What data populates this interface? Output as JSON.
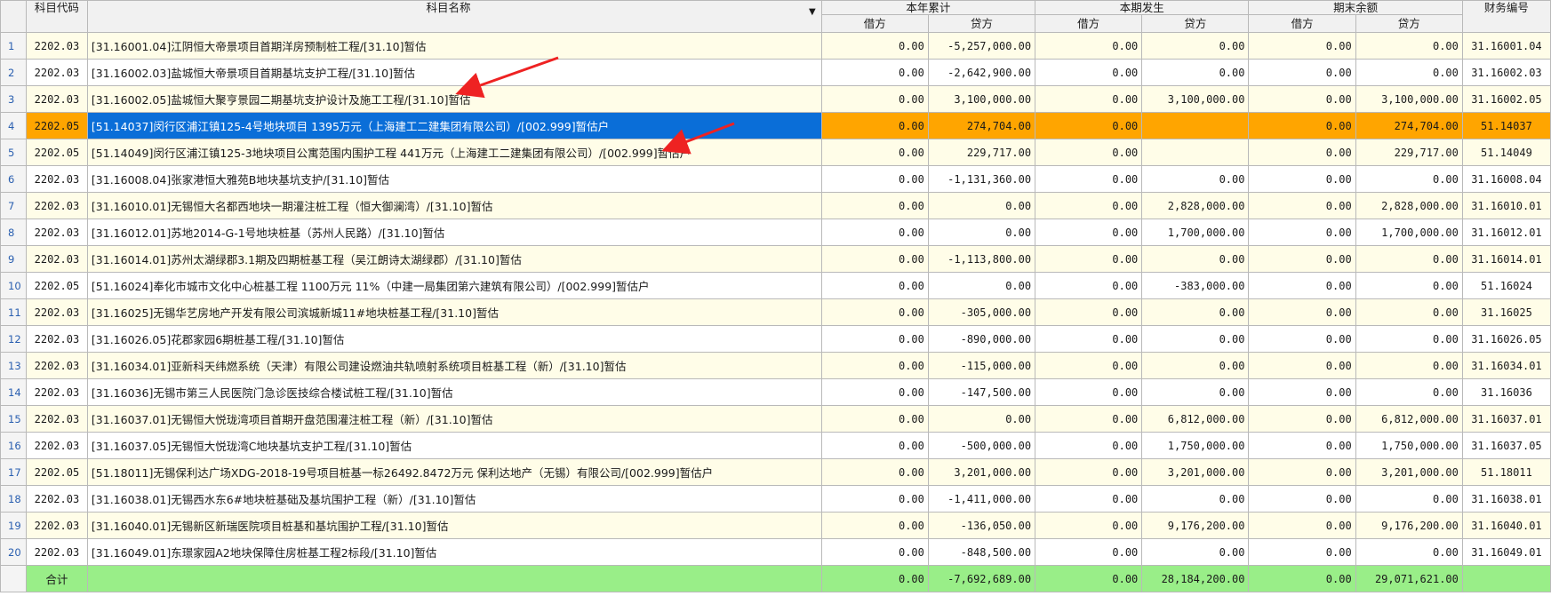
{
  "header": {
    "col_code": "科目代码",
    "col_name": "科目名称",
    "sort_icon": "sort-down-icon",
    "group_ytd": "本年累计",
    "group_period": "本期发生",
    "group_ending": "期末余额",
    "col_fin": "财务编号",
    "debit": "借方",
    "credit": "贷方"
  },
  "rows": [
    {
      "n": "1",
      "code": "2202.03",
      "name": "[31.16001.04]江阴恒大帝景项目首期洋房预制桩工程/[31.10]暂估",
      "ytd_d": "0.00",
      "ytd_c": "-5,257,000.00",
      "per_d": "0.00",
      "per_c": "0.00",
      "end_d": "0.00",
      "end_c": "0.00",
      "fin": "31.16001.04"
    },
    {
      "n": "2",
      "code": "2202.03",
      "name": "[31.16002.03]盐城恒大帝景项目首期基坑支护工程/[31.10]暂估",
      "ytd_d": "0.00",
      "ytd_c": "-2,642,900.00",
      "per_d": "0.00",
      "per_c": "0.00",
      "end_d": "0.00",
      "end_c": "0.00",
      "fin": "31.16002.03"
    },
    {
      "n": "3",
      "code": "2202.03",
      "name": "[31.16002.05]盐城恒大聚亨景园二期基坑支护设计及施工工程/[31.10]暂估",
      "ytd_d": "0.00",
      "ytd_c": "3,100,000.00",
      "per_d": "0.00",
      "per_c": "3,100,000.00",
      "end_d": "0.00",
      "end_c": "3,100,000.00",
      "fin": "31.16002.05"
    },
    {
      "n": "4",
      "code": "2202.05",
      "name": "[51.14037]闵行区浦江镇125-4号地块项目 1395万元（上海建工二建集团有限公司）/[002.999]暂估户",
      "ytd_d": "0.00",
      "ytd_c": "274,704.00",
      "per_d": "0.00",
      "per_c": "",
      "end_d": "0.00",
      "end_c": "274,704.00",
      "fin": "51.14037"
    },
    {
      "n": "5",
      "code": "2202.05",
      "name": "[51.14049]闵行区浦江镇125-3地块项目公寓范围内围护工程  441万元（上海建工二建集团有限公司）/[002.999]暂估户",
      "ytd_d": "0.00",
      "ytd_c": "229,717.00",
      "per_d": "0.00",
      "per_c": "",
      "end_d": "0.00",
      "end_c": "229,717.00",
      "fin": "51.14049"
    },
    {
      "n": "6",
      "code": "2202.03",
      "name": "[31.16008.04]张家港恒大雅苑B地块基坑支护/[31.10]暂估",
      "ytd_d": "0.00",
      "ytd_c": "-1,131,360.00",
      "per_d": "0.00",
      "per_c": "0.00",
      "end_d": "0.00",
      "end_c": "0.00",
      "fin": "31.16008.04"
    },
    {
      "n": "7",
      "code": "2202.03",
      "name": "[31.16010.01]无锡恒大名都西地块一期灌注桩工程（恒大御澜湾）/[31.10]暂估",
      "ytd_d": "0.00",
      "ytd_c": "0.00",
      "per_d": "0.00",
      "per_c": "2,828,000.00",
      "end_d": "0.00",
      "end_c": "2,828,000.00",
      "fin": "31.16010.01"
    },
    {
      "n": "8",
      "code": "2202.03",
      "name": "[31.16012.01]苏地2014-G-1号地块桩基（苏州人民路）/[31.10]暂估",
      "ytd_d": "0.00",
      "ytd_c": "0.00",
      "per_d": "0.00",
      "per_c": "1,700,000.00",
      "end_d": "0.00",
      "end_c": "1,700,000.00",
      "fin": "31.16012.01"
    },
    {
      "n": "9",
      "code": "2202.03",
      "name": "[31.16014.01]苏州太湖绿郡3.1期及四期桩基工程（吴江朗诗太湖绿郡）/[31.10]暂估",
      "ytd_d": "0.00",
      "ytd_c": "-1,113,800.00",
      "per_d": "0.00",
      "per_c": "0.00",
      "end_d": "0.00",
      "end_c": "0.00",
      "fin": "31.16014.01"
    },
    {
      "n": "10",
      "code": "2202.05",
      "name": "[51.16024]奉化市城市文化中心桩基工程 1100万元  11%（中建一局集团第六建筑有限公司）/[002.999]暂估户",
      "ytd_d": "0.00",
      "ytd_c": "0.00",
      "per_d": "0.00",
      "per_c": "-383,000.00",
      "end_d": "0.00",
      "end_c": "0.00",
      "fin": "51.16024"
    },
    {
      "n": "11",
      "code": "2202.03",
      "name": "[31.16025]无锡华艺房地产开发有限公司滨城新城11#地块桩基工程/[31.10]暂估",
      "ytd_d": "0.00",
      "ytd_c": "-305,000.00",
      "per_d": "0.00",
      "per_c": "0.00",
      "end_d": "0.00",
      "end_c": "0.00",
      "fin": "31.16025"
    },
    {
      "n": "12",
      "code": "2202.03",
      "name": "[31.16026.05]花郡家园6期桩基工程/[31.10]暂估",
      "ytd_d": "0.00",
      "ytd_c": "-890,000.00",
      "per_d": "0.00",
      "per_c": "0.00",
      "end_d": "0.00",
      "end_c": "0.00",
      "fin": "31.16026.05"
    },
    {
      "n": "13",
      "code": "2202.03",
      "name": "[31.16034.01]亚新科天纬燃系统（天津）有限公司建设燃油共轨喷射系统项目桩基工程（新）/[31.10]暂估",
      "ytd_d": "0.00",
      "ytd_c": "-115,000.00",
      "per_d": "0.00",
      "per_c": "0.00",
      "end_d": "0.00",
      "end_c": "0.00",
      "fin": "31.16034.01"
    },
    {
      "n": "14",
      "code": "2202.03",
      "name": "[31.16036]无锡市第三人民医院门急诊医技综合楼试桩工程/[31.10]暂估",
      "ytd_d": "0.00",
      "ytd_c": "-147,500.00",
      "per_d": "0.00",
      "per_c": "0.00",
      "end_d": "0.00",
      "end_c": "0.00",
      "fin": "31.16036"
    },
    {
      "n": "15",
      "code": "2202.03",
      "name": "[31.16037.01]无锡恒大悦珑湾项目首期开盘范围灌注桩工程（新）/[31.10]暂估",
      "ytd_d": "0.00",
      "ytd_c": "0.00",
      "per_d": "0.00",
      "per_c": "6,812,000.00",
      "end_d": "0.00",
      "end_c": "6,812,000.00",
      "fin": "31.16037.01"
    },
    {
      "n": "16",
      "code": "2202.03",
      "name": "[31.16037.05]无锡恒大悦珑湾C地块基坑支护工程/[31.10]暂估",
      "ytd_d": "0.00",
      "ytd_c": "-500,000.00",
      "per_d": "0.00",
      "per_c": "1,750,000.00",
      "end_d": "0.00",
      "end_c": "1,750,000.00",
      "fin": "31.16037.05"
    },
    {
      "n": "17",
      "code": "2202.05",
      "name": "[51.18011]无锡保利达广场XDG-2018-19号项目桩基一标26492.8472万元 保利达地产（无锡）有限公司/[002.999]暂估户",
      "ytd_d": "0.00",
      "ytd_c": "3,201,000.00",
      "per_d": "0.00",
      "per_c": "3,201,000.00",
      "end_d": "0.00",
      "end_c": "3,201,000.00",
      "fin": "51.18011"
    },
    {
      "n": "18",
      "code": "2202.03",
      "name": "[31.16038.01]无锡西水东6#地块桩基础及基坑围护工程（新）/[31.10]暂估",
      "ytd_d": "0.00",
      "ytd_c": "-1,411,000.00",
      "per_d": "0.00",
      "per_c": "0.00",
      "end_d": "0.00",
      "end_c": "0.00",
      "fin": "31.16038.01"
    },
    {
      "n": "19",
      "code": "2202.03",
      "name": "[31.16040.01]无锡新区新瑞医院项目桩基和基坑围护工程/[31.10]暂估",
      "ytd_d": "0.00",
      "ytd_c": "-136,050.00",
      "per_d": "0.00",
      "per_c": "9,176,200.00",
      "end_d": "0.00",
      "end_c": "9,176,200.00",
      "fin": "31.16040.01"
    },
    {
      "n": "20",
      "code": "2202.03",
      "name": "[31.16049.01]东璟家园A2地块保障住房桩基工程2标段/[31.10]暂估",
      "ytd_d": "0.00",
      "ytd_c": "-848,500.00",
      "per_d": "0.00",
      "per_c": "0.00",
      "end_d": "0.00",
      "end_c": "0.00",
      "fin": "31.16049.01"
    }
  ],
  "total": {
    "label": "合计",
    "ytd_d": "0.00",
    "ytd_c": "-7,692,689.00",
    "per_d": "0.00",
    "per_c": "28,184,200.00",
    "end_d": "0.00",
    "end_c": "29,071,621.00"
  },
  "selected_row": 4,
  "colors": {
    "selected_name_bg": "#0a6ed8",
    "selected_cell_bg": "#ffa500",
    "odd_row_bg": "#fffde8",
    "total_row_bg": "#99ee88",
    "annotation_arrow": "#ee2222"
  }
}
